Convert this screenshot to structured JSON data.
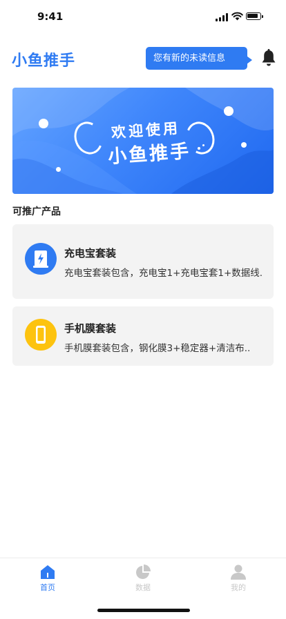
{
  "status_bar": {
    "time": "9:41"
  },
  "header": {
    "app_title": "小鱼推手",
    "notification": "您有新的未读信息"
  },
  "banner": {
    "line1": "欢迎使用",
    "line2": "小鱼推手"
  },
  "section": {
    "title": "可推广产品"
  },
  "products": [
    {
      "name": "充电宝套装",
      "description": "充电宝套装包含，充电宝1+充电宝套1+数据线.",
      "icon": "power-bank-icon",
      "color": "#2f7bf2"
    },
    {
      "name": "手机膜套装",
      "description": "手机膜套装包含，钢化膜3+稳定器+清洁布..",
      "icon": "phone-icon",
      "color": "#fdc30f"
    }
  ],
  "tabs": [
    {
      "label": "首页",
      "icon": "home-icon",
      "active": true
    },
    {
      "label": "数据",
      "icon": "pie-chart-icon",
      "active": false
    },
    {
      "label": "我的",
      "icon": "user-icon",
      "active": false
    }
  ],
  "colors": {
    "accent": "#2f7bf2",
    "inactive": "#c8c8c8"
  }
}
